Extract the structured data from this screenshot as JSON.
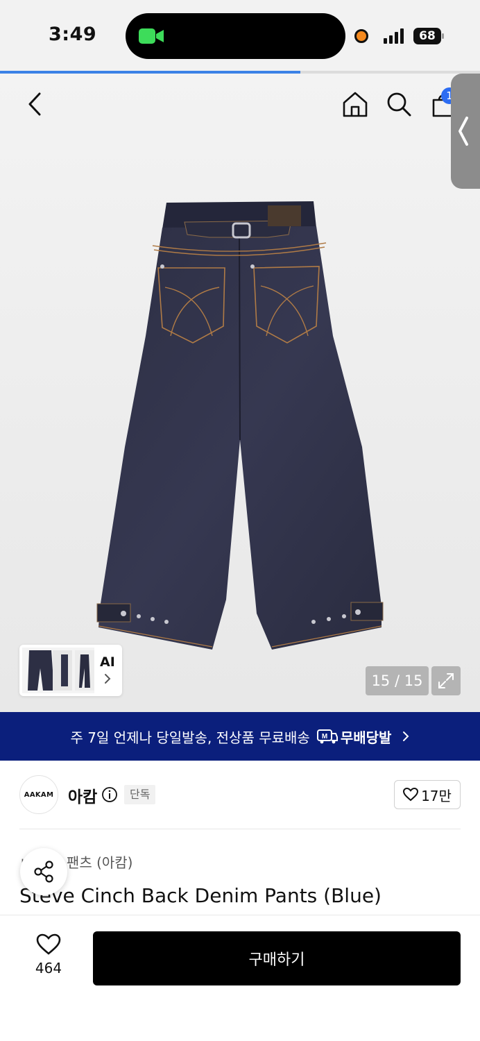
{
  "status_bar": {
    "time": "3:49",
    "battery": "68",
    "icons": [
      "facetime-camera-icon",
      "recording-dot-icon",
      "cellular-signal-icon",
      "battery-icon"
    ]
  },
  "page_progress": 0.625,
  "header": {
    "icons": [
      "back-chevron-icon",
      "home-icon",
      "search-icon",
      "shopping-bag-icon"
    ],
    "cart_badge": "1"
  },
  "gallery": {
    "thumbnail_label": "AI",
    "counter": "15 / 15",
    "product_image": "jeans-back-view"
  },
  "banner": {
    "text": "주 7일 언제나 당일발송, 전상품 무료배송",
    "brand": "무배당발",
    "logo_letter": "M"
  },
  "brand": {
    "logo_text": "AAKAM",
    "name": "아캄",
    "badge": "단독",
    "likes": "17만"
  },
  "product": {
    "name_ko": "ㅂ      데님 팬츠 (아캄)",
    "name_en": "Steve Cinch Back Denim Pants (Blue)"
  },
  "bottom_bar": {
    "wish_count": "464",
    "buy_label": "구매하기"
  },
  "colors": {
    "banner_bg": "#0b1f7c",
    "badge_blue": "#2c6cf2",
    "buy_button": "#000000",
    "progress": "#3b82e6"
  }
}
